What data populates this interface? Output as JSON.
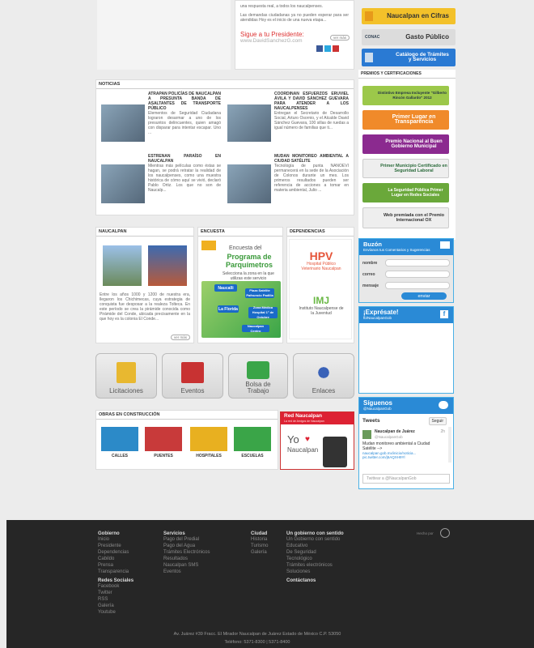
{
  "top": {
    "intro_text": "una respuesta real, a todos los naucalpenses.",
    "intro_text2": "Las demandas ciudadanas ya no pueden esperar para ser atendidas Hoy es el inicio de una nueva etapa...",
    "more_label": "ver más",
    "follow_label": "Sigue a tu Presidente:",
    "follow_site": "www.DavidSanchezG.com"
  },
  "right_banners": [
    {
      "label": "Naucalpan en Cifras",
      "color": "#f3c12a"
    },
    {
      "label": "Gasto Público",
      "color": "#dcdcdc"
    },
    {
      "label": "Catálogo de Trámites y Servicios",
      "color": "#2a7ad3"
    }
  ],
  "awards": {
    "title": "PREMIOS Y CERTIFICACIONES",
    "items": [
      {
        "label": "Distintivo Empresa Incluyente \"Gilberto Rincón Gallardo\" 2012",
        "color": "#9cc84a"
      },
      {
        "label": "Primer Lugar en Transparencia",
        "color": "#f08a2a"
      },
      {
        "label": "Premio Nacional al Buen Gobierno Municipal",
        "color": "#8b2a8f"
      },
      {
        "label": "Primer Municipio Certificado en Seguridad Laboral",
        "color": "#e8e8e8"
      },
      {
        "label": "La Seguridad Pública Primer Lugar en Redes Sociales",
        "color": "#6aa83a"
      },
      {
        "label": "Web premiada con el Premio Internacional OX",
        "color": "#e6e6e6"
      }
    ]
  },
  "news": {
    "title": "NOTICIAS",
    "items": [
      {
        "title": "ATRAPAN POLICÍAS DE NAUCALPAN A PRESUNTA BANDA DE ASALTANTES DE TRANSPORTE PÚBLICO",
        "body": "Elementos de Seguridad Ciudadana lograron desarmar a uno de los presuntos delincuentes, quien amagó con disparar para intentar escapar. Uno ..."
      },
      {
        "title": "COORDINAN ESFUERZOS ERUVIEL ÁVILA Y DAVID SÁNCHEZ GUEVARA PARA ATENDER A LOS NAUCALPENSES",
        "body": "Entregan el Secretario de Desarrollo Social, Arturo Osornio, y el Alcalde David Sánchez Guevara, 100 sillas de ruedas a igual número de familias que ti..."
      },
      {
        "title": "ESTRENAN PARAÍSO EN NAUCALPAN",
        "body": "Mientras más películas como éstas se hagan, se podrá retratar la realidad de los naucalpenses, como una muestra histórica de cómo aquí se vivió, declaró Pablo Ortiz. Los que no son de Naucalp..."
      },
      {
        "title": "MUDAN MONITOREO AMBIENTAL A CIUDAD SATÉLITE",
        "body": "Tecnología de punta NANOEVI permanecerá en la sede de la Asociación de Colonos durante un mes. Los primeros resultados pueden ser referencia de acciones a tomar en materia ambiental, Julio ..."
      }
    ]
  },
  "naucalpan": {
    "title": "NAUCALPAN",
    "body": "Entre los años 1000 y 1200 de nuestra era, llegaron los Chichimecas, cuya estrategia de conquista fue desposar a la realeza Tolteca. En este período se crea la pirámide conocida como Pirámide del Conde, ubicada precisamente en la que hoy es la colonia El Conde...",
    "more_label": "ver más"
  },
  "encuesta": {
    "title": "ENCUESTA",
    "heading1": "Encuesta del",
    "heading2": "Programa de Parquímetros",
    "sub": "Selecciona la zona en la que utilizas este servicio",
    "zones": [
      "Naucalli",
      "Plaza Satélite Pafnuncio Padilla",
      "La Florida",
      "Zona Médica Hospital 1° de Octubre",
      "Naucalpan Centro"
    ]
  },
  "dependencias": {
    "title": "DEPENDENCIAS",
    "items": [
      "Hospital Público Veterinario Naucalpan",
      "Instituto Naucalpense de la Juventud"
    ]
  },
  "tiles": [
    {
      "label": "Licitaciones",
      "icon": "document-icon",
      "color": "#e8b830"
    },
    {
      "label": "Eventos",
      "icon": "calendar-icon",
      "color": "#c83232"
    },
    {
      "label": "Bolsa de Trabajo",
      "icon": "briefcase-icon",
      "color": "#3aa548"
    },
    {
      "label": "Enlaces",
      "icon": "network-icon",
      "color": "#3a62b8"
    }
  ],
  "obras": {
    "title": "OBRAS EN CONSTRUCCIÓN",
    "items": [
      {
        "label": "CALLES",
        "color": "#2c8ac8"
      },
      {
        "label": "PUENTES",
        "color": "#c83a3a"
      },
      {
        "label": "HOSPITALES",
        "color": "#e8b020"
      },
      {
        "label": "ESCUELAS",
        "color": "#3aa548"
      }
    ]
  },
  "red": {
    "title": "Red Naucalpan",
    "subtitle": "La red de Amigos de Naucalpan",
    "yo": "Yo",
    "brand": "Naucalpan"
  },
  "buzon": {
    "title": "Buzón",
    "subtitle": "Envíanos tus Comentarios y Sugerencias",
    "fields": [
      "nombre",
      "correo",
      "mensaje"
    ],
    "send_label": "enviar"
  },
  "expresate": {
    "title": "¡Exprésate!",
    "handle": "fb/NaucalpanGob"
  },
  "twitter": {
    "title": "Síguenos",
    "handle": "@NaucalpanGob",
    "tweets_label": "Tweets",
    "follow_label": "Seguir",
    "tweet_name": "Naucalpan de Juárez",
    "tweet_handle": "@NaucalpanGob",
    "tweet_time": "2h",
    "tweet_text": "Mudan monitoreo ambiental a Ciudad Satélite -->",
    "tweet_link": "naucalpan.gob.mx/inicio/noticia... pic.twitter.com/j5AQXH9Yl",
    "compose_placeholder": "Twittear a @NaucalpanGob"
  },
  "footer": {
    "made_by": "Hecho por",
    "columns": [
      {
        "title": "Gobierno",
        "items": [
          "Inicio",
          "Presidente",
          "Dependencias",
          "Cabildo",
          "Prensa",
          "Transparencia"
        ]
      },
      {
        "title": "Servicios",
        "items": [
          "Pago del Predial",
          "Pago del Agua",
          "Trámites Electrónicos",
          "Resultados",
          "Naucalpan SMS",
          "Eventos"
        ]
      },
      {
        "title": "Ciudad",
        "items": [
          "Historia",
          "Turismo",
          "Galería"
        ]
      },
      {
        "title": "Un gobierno con sentido",
        "items": [
          "Un Gobierno con sentido",
          "Educativo",
          "De Seguridad",
          "Tecnológico",
          "Trámites electrónicos",
          "Soluciones"
        ]
      }
    ],
    "social_title": "Redes Sociales",
    "social_items": [
      "Facebook",
      "Twitter",
      "RSS",
      "Galería",
      "Youtube"
    ],
    "contact_title": "Contáctanos",
    "address": "Av. Juárez #39 Fracc. El Mirador Naucalpan de Juárez Estado de México C.P. 53050",
    "phone": "Teléfono: 5371-8300 | 5371-8400"
  }
}
